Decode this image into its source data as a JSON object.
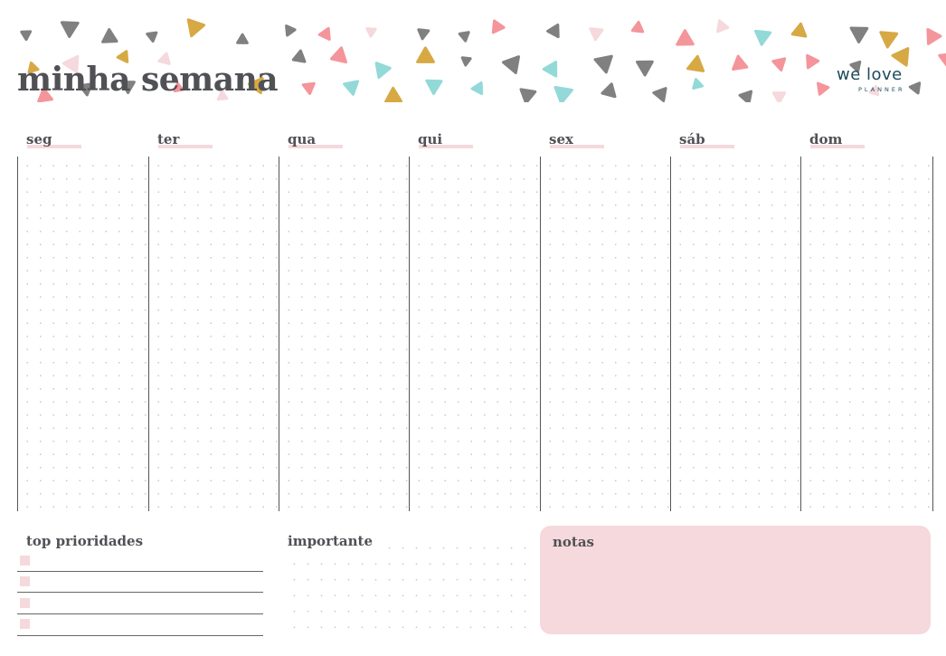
{
  "header": {
    "title": "minha semana"
  },
  "logo": {
    "line1": "we love",
    "line2": "PLANNER"
  },
  "days": [
    {
      "label": "seg"
    },
    {
      "label": "ter"
    },
    {
      "label": "qua"
    },
    {
      "label": "qui"
    },
    {
      "label": "sex"
    },
    {
      "label": "sáb"
    },
    {
      "label": "dom"
    }
  ],
  "bottom": {
    "priorities_title": "top prioridades",
    "important_title": "importante",
    "notes_title": "notas"
  },
  "colors": {
    "pink": "#f5d9dc",
    "coral": "#f4959b",
    "teal": "#93d9d8",
    "gold": "#d7a944",
    "gray": "#808080",
    "text": "#505155"
  }
}
